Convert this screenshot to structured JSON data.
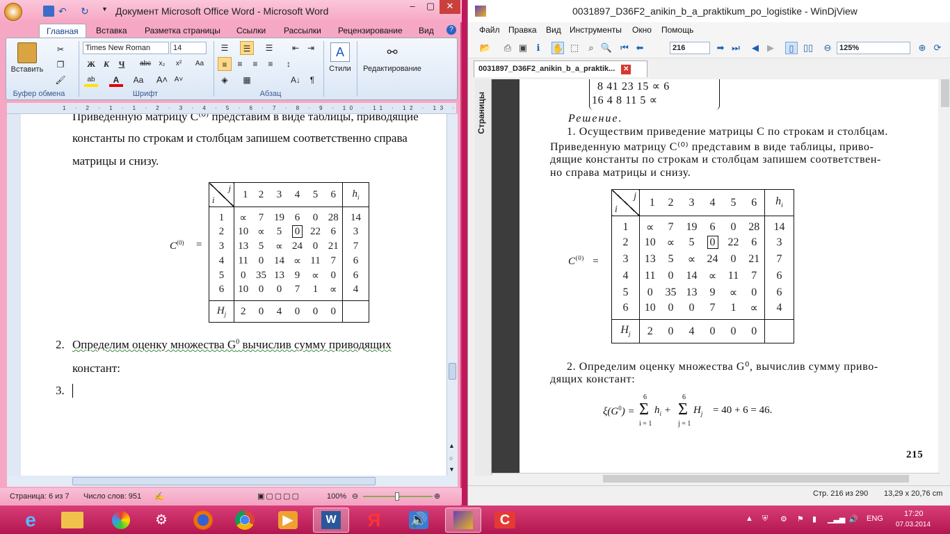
{
  "word": {
    "title": "Документ Microsoft Office Word - Microsoft Word",
    "window_controls": [
      "–",
      "▢",
      "✕"
    ],
    "tabs": [
      "Главная",
      "Вставка",
      "Разметка страницы",
      "Ссылки",
      "Рассылки",
      "Рецензирование",
      "Вид"
    ],
    "active_tab": "Главная",
    "ribbon": {
      "paste_label": "Вставить",
      "clipboard_group": "Буфер обмена",
      "font_name": "Times New Roman",
      "font_size": "14",
      "font_group": "Шрифт",
      "paragraph_group": "Абзац",
      "styles_label": "Стили",
      "styles_group": "Стили",
      "editing_label": "Редактирование",
      "bold": "Ж",
      "italic": "К",
      "underline": "Ч"
    },
    "ruler_text": "1 · 2 · 1 · 1 · 2 · 3 · 4 · 5 · 6 · 7 · 8 · 9 · 10 · 11 · 12 · 13 · 14 · 15 ·",
    "doc": {
      "line0": "Приведенную матрицу C⁽⁰⁾ представим в виде таблицы, приводящие",
      "line1": "константы по строкам и столбцам запишем соответственно справа",
      "line2": "матрицы и снизу.",
      "matrix_label": "C(0)",
      "equals": "=",
      "item2_num": "2.",
      "item2_text_a": "Определим оценку множества G",
      "item2_sup": "0",
      "item2_text_b": " вычислив сумму приводящих",
      "item2_line2": "констант:",
      "item3_num": "3."
    },
    "status": {
      "page": "Страница: 6 из 7",
      "words": "Число слов: 951",
      "zoom": "100%"
    }
  },
  "matrix": {
    "corner_j": "j",
    "corner_i": "i",
    "col_headers": [
      "1",
      "2",
      "3",
      "4",
      "5",
      "6"
    ],
    "h_header": "hi",
    "rows": [
      {
        "i": "1",
        "cells": [
          "∝",
          "7",
          "19",
          "6",
          "0",
          "28"
        ],
        "h": "14"
      },
      {
        "i": "2",
        "cells": [
          "10",
          "∝",
          "5",
          "0",
          "22",
          "6"
        ],
        "h": "3"
      },
      {
        "i": "3",
        "cells": [
          "13",
          "5",
          "∝",
          "24",
          "0",
          "21"
        ],
        "h": "7"
      },
      {
        "i": "4",
        "cells": [
          "11",
          "0",
          "14",
          "∝",
          "11",
          "7"
        ],
        "h": "6"
      },
      {
        "i": "5",
        "cells": [
          "0",
          "35",
          "13",
          "9",
          "∝",
          "0"
        ],
        "h": "6"
      },
      {
        "i": "6",
        "cells": [
          "10",
          "0",
          "0",
          "7",
          "1",
          "∝"
        ],
        "h": "4"
      }
    ],
    "boxed_cell": "0",
    "H_label": "Hj",
    "H_values": [
      "2",
      "0",
      "4",
      "0",
      "0",
      "0"
    ]
  },
  "djview": {
    "title": "0031897_D36F2_anikin_b_a_praktikum_po_logistike - WinDjView",
    "menu": [
      "Файл",
      "Правка",
      "Вид",
      "Инструменты",
      "Окно",
      "Помощь"
    ],
    "page_number": "216",
    "zoom": "125%",
    "doc_tab": "0031897_D36F2_anikin_b_a_praktik...",
    "side_tab": "Страницы",
    "page": {
      "prev_row1": "8  41  23  15  ∝  6",
      "prev_row2": "16  4  8  11  5  ∝",
      "solution": "Решение.",
      "p1_l1": "1. Осуществим приведение матрицы C по строкам и столбцам.",
      "p1_l2": "Приведенную матрицу C⁽⁰⁾ представим в виде таблицы, приво-",
      "p1_l3": "дящие константы по строкам и столбцам запишем соответствен-",
      "p1_l4": "но справа матрицы и снизу.",
      "p2_l1": "2. Определим оценку множества G⁰, вычислив сумму приво-",
      "p2_l2": "дящих констант:",
      "formula": "ξ(G⁰) = Σ hᵢ + Σ Hⱼ = 40 + 6 = 46.",
      "sum_top": "6",
      "sum_bot_i": "i = 1",
      "sum_bot_j": "j = 1",
      "page_num": "215"
    },
    "status": {
      "page_of": "Стр. 216 из 290",
      "size": "13,29 x 20,76 cm"
    }
  },
  "taskbar": {
    "lang": "ENG",
    "time": "17:20",
    "date": "07.03.2014"
  }
}
